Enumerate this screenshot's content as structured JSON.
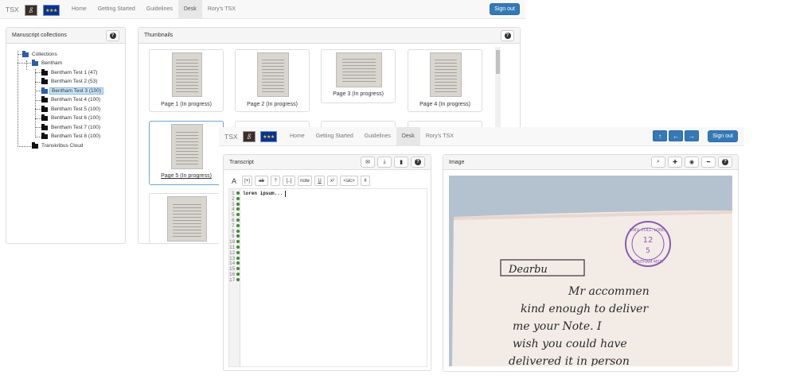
{
  "nav": {
    "brand": "TSX",
    "links": [
      "Home",
      "Getting Started",
      "Guidelines",
      "Desk",
      "Rory's TSX"
    ],
    "active": "Desk",
    "signout": "Sign out"
  },
  "collections": {
    "title": "Manuscript collections",
    "root": "Collections",
    "group": "Bentham",
    "items": [
      "Bentham Test 1 (47)",
      "Bentham Test 2 (53)",
      "Bentham Test 3 (100)",
      "Bentham Test 4 (100)",
      "Bentham Test 5 (100)",
      "Bentham Test 6 (100)",
      "Bentham Test 7 (100)",
      "Bentham Test 8 (100)"
    ],
    "selected_index": 2,
    "other": "Transkribus Cloud"
  },
  "thumbnails": {
    "title": "Thumbnails",
    "pages": [
      "Page 1 (In progress)",
      "Page 2 (In progress)",
      "Page 3 (In progress)",
      "Page 4 (In progress)",
      "Page 5 (In progress)"
    ]
  },
  "desk_nav": {
    "brand": "TSX",
    "links": [
      "Home",
      "Getting Started",
      "Guidelines",
      "Desk",
      "Rory's TSX"
    ],
    "signout": "Sign out"
  },
  "transcript": {
    "title": "Transcript",
    "toolbar": [
      "A",
      "[+]",
      "ab",
      "?",
      "[..]",
      "note",
      "U",
      "x²",
      "<sic>",
      "ǂ"
    ],
    "first_line": "loren ipsum...",
    "line_numbers": [
      "1",
      "2",
      "3",
      "4",
      "5",
      "6",
      "7",
      "8",
      "9",
      "10",
      "11",
      "12",
      "13",
      "14",
      "15",
      "16",
      "17"
    ]
  },
  "image": {
    "title": "Image",
    "stamp": "UNIV. COLL. LOND. 12 5 BENTHAM MSS.",
    "heading": "Dearbu",
    "handwriting": [
      "Mr accommen",
      "kind enough to deliver",
      "me your Note. I",
      "wish you could have",
      "delivered it in person"
    ]
  },
  "colors": {
    "primary": "#337ab7",
    "selected": "#c8e4f8",
    "navbg": "#f8f8f8"
  },
  "icons": [
    "help-icon",
    "envelope-icon",
    "download-icon",
    "file-icon",
    "search-icon",
    "plus-icon",
    "target-icon",
    "minus-icon",
    "arrow-up-icon",
    "arrow-left-icon",
    "arrow-right-icon",
    "folder-icon"
  ]
}
